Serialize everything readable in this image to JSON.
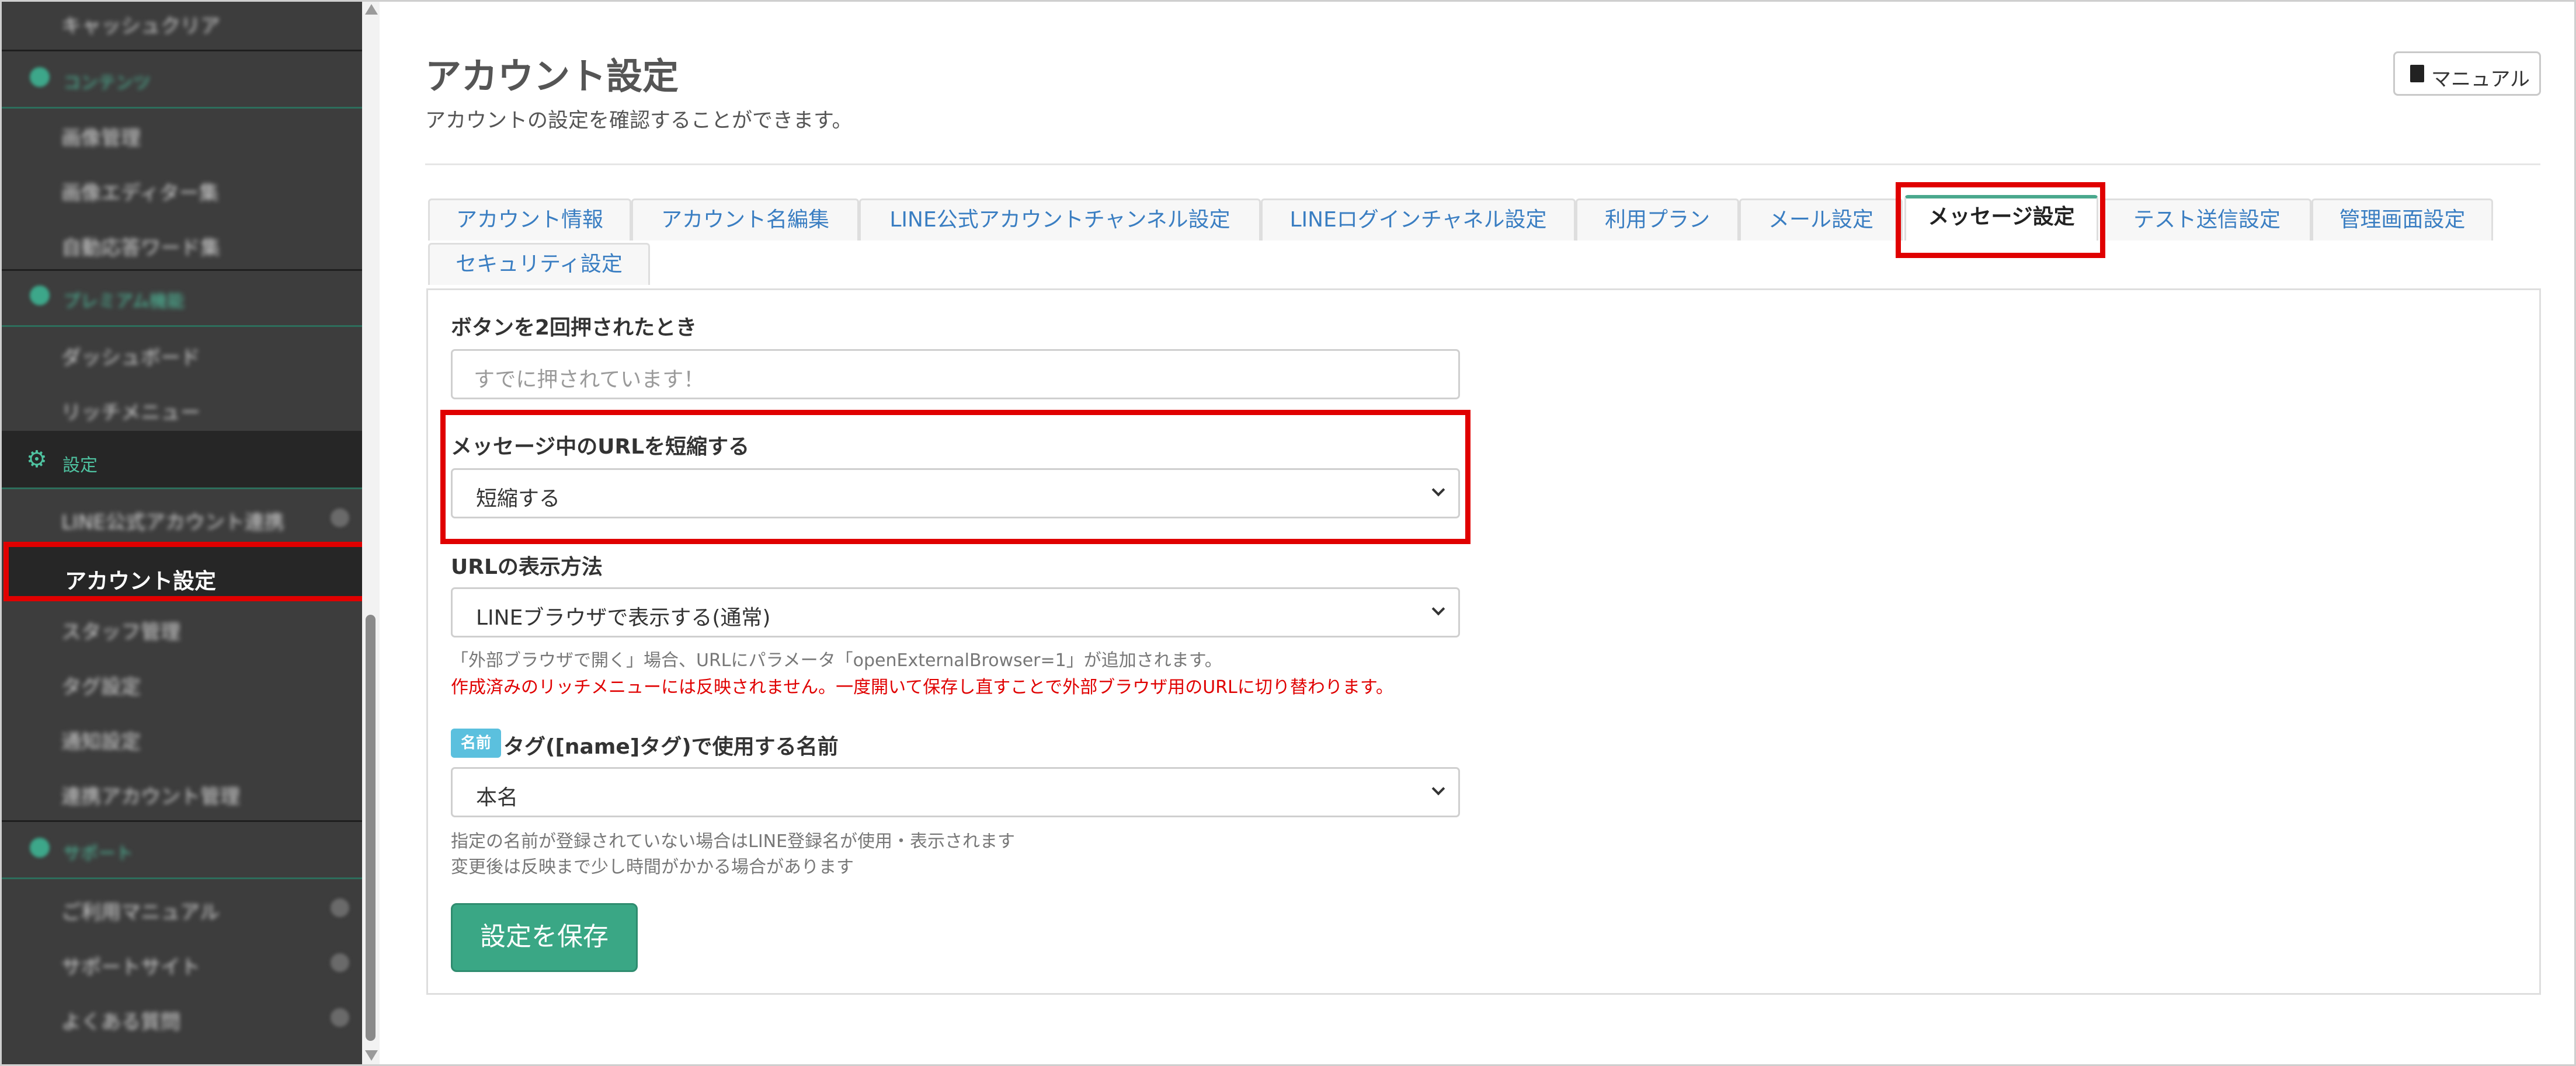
{
  "sidebar": {
    "items": [
      {
        "label": "キャッシュクリア",
        "type": "item"
      },
      {
        "label": "コンテンツ",
        "type": "section"
      },
      {
        "label": "画像管理",
        "type": "item"
      },
      {
        "label": "画像エディター集",
        "type": "item"
      },
      {
        "label": "自動応答ワード集",
        "type": "item"
      },
      {
        "label": "プレミアム機能",
        "type": "section"
      },
      {
        "label": "ダッシュボード",
        "type": "item"
      },
      {
        "label": "リッチメニュー",
        "type": "item"
      }
    ],
    "settings_section": "設定",
    "settings_items_before": [
      {
        "label": "LINE公式アカウント連携",
        "badge": true
      }
    ],
    "active_item": "アカウント設定",
    "settings_items_after": [
      {
        "label": "スタッフ管理",
        "badge": false
      },
      {
        "label": "タグ設定",
        "badge": false
      },
      {
        "label": "通知設定",
        "badge": false
      },
      {
        "label": "連携アカウント管理",
        "badge": false
      }
    ],
    "support_section": "サポート",
    "support_items": [
      {
        "label": "ご利用マニュアル",
        "badge": true
      },
      {
        "label": "サポートサイト",
        "badge": true
      },
      {
        "label": "よくある質問",
        "badge": true
      }
    ]
  },
  "header": {
    "title": "アカウント設定",
    "subtitle": "アカウントの設定を確認することができます。",
    "manual_label": "マニュアル"
  },
  "tabs": [
    {
      "label": "アカウント情報",
      "active": false
    },
    {
      "label": "アカウント名編集",
      "active": false
    },
    {
      "label": "LINE公式アカウントチャンネル設定",
      "active": false
    },
    {
      "label": "LINEログインチャネル設定",
      "active": false
    },
    {
      "label": "利用プラン",
      "active": false
    },
    {
      "label": "メール設定",
      "active": false
    },
    {
      "label": "メッセージ設定",
      "active": true
    },
    {
      "label": "テスト送信設定",
      "active": false
    },
    {
      "label": "管理画面設定",
      "active": false
    },
    {
      "label": "セキュリティ設定",
      "active": false
    }
  ],
  "form": {
    "double_click": {
      "label": "ボタンを2回押されたとき",
      "placeholder": "すでに押されています！"
    },
    "shorten_url": {
      "label": "メッセージ中のURLを短縮する",
      "value": "短縮する"
    },
    "url_display": {
      "label": "URLの表示方法",
      "value": "LINEブラウザで表示する(通常)",
      "help": "「外部ブラウザで開く」場合、URLにパラメータ「openExternalBrowser=1」が追加されます。",
      "warning": "作成済みのリッチメニューには反映されません。一度開いて保存し直すことで外部ブラウザ用のURLに切り替わります。"
    },
    "name_tag": {
      "badge": "名前",
      "label": "タグ([name]タグ)で使用する名前",
      "value": "本名",
      "help1": "指定の名前が登録されていない場合はLINE登録名が使用・表示されます",
      "help2": "変更後は反映まで少し時間がかかる場合があります"
    },
    "save_label": "設定を保存"
  },
  "colors": {
    "accent": "#3aa785",
    "highlight": "#e00000",
    "link": "#3a7ec2",
    "sidebar_bg": "#3d3d3d"
  }
}
